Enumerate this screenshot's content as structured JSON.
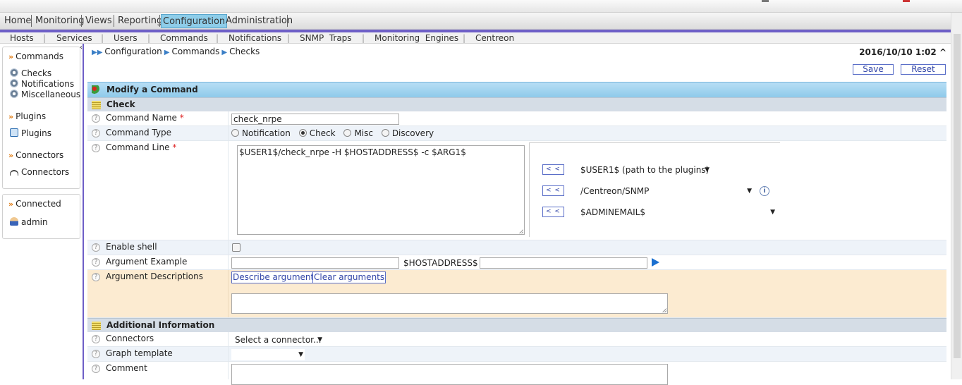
{
  "main_menu": [
    "Home",
    "Monitoring",
    "Views",
    "Reporting",
    "Configuration",
    "Administration"
  ],
  "active_menu": "Configuration",
  "sub_menu": [
    "Hosts",
    "Services",
    "Users",
    "Commands",
    "Notifications",
    "SNMP  Traps",
    "Monitoring  Engines",
    "Centreon"
  ],
  "sidebar": {
    "commands_title": "Commands",
    "commands_items": [
      "Checks",
      "Notifications",
      "Miscellaneous"
    ],
    "plugins_title": "Plugins",
    "plugins_item": "Plugins",
    "connectors_title": "Connectors",
    "connectors_item": "Connectors",
    "connected_title": "Connected",
    "user": "admin"
  },
  "breadcrumb": [
    "Configuration",
    "Commands",
    "Checks"
  ],
  "datetime": "2016/10/10 1:02",
  "buttons": {
    "save": "Save",
    "reset": "Reset"
  },
  "form": {
    "title": "Modify a Command",
    "section_check": "Check",
    "command_name_label": "Command Name",
    "command_name_value": "check_nrpe",
    "command_type_label": "Command Type",
    "command_type_options": [
      "Notification",
      "Check",
      "Misc",
      "Discovery"
    ],
    "command_type_selected": "Check",
    "command_line_label": "Command Line",
    "command_line_value": "$USER1$/check_nrpe -H $HOSTADDRESS$ -c $ARG1$",
    "macro_button": "< <",
    "macros": [
      "$USER1$ (path to the plugins)",
      "/Centreon/SNMP",
      "$ADMINEMAIL$"
    ],
    "enable_shell_label": "Enable shell",
    "argument_example_label": "Argument Example",
    "argument_example_value": "",
    "hostaddress_label": "$HOSTADDRESS$",
    "hostaddress_value": "",
    "argument_descriptions_label": "Argument Descriptions",
    "describe_arguments": "Describe arguments",
    "clear_arguments": "Clear arguments",
    "section_additional": "Additional Information",
    "connectors_label": "Connectors",
    "connectors_value": "Select a connector...",
    "graph_template_label": "Graph template",
    "graph_template_value": "",
    "comment_label": "Comment",
    "required_marker": "*",
    "help_marker": "?"
  },
  "colors": {
    "accent": "#6e5fc7",
    "header_blue": "#8ecaea",
    "section_gray": "#d5dde6",
    "peach": "#fcebd1",
    "active_menu": "#8ecde9"
  }
}
